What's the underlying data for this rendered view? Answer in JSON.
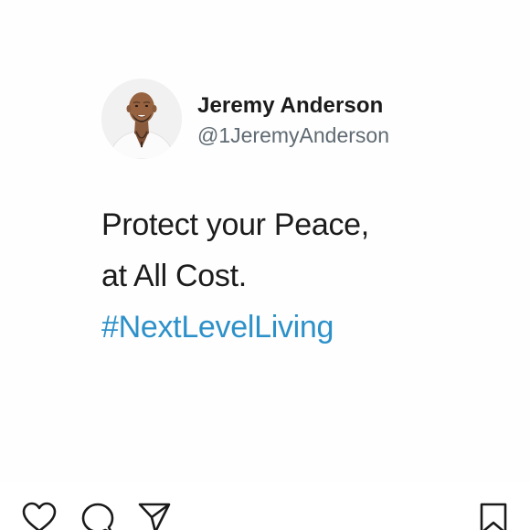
{
  "post": {
    "author_name": "Jeremy Anderson",
    "author_handle": "@1JeremyAnderson",
    "text_lines": [
      "Protect your Peace,",
      "at All Cost."
    ],
    "hashtag": "#NextLevelLiving",
    "hashtag_color": "#2d91c9"
  },
  "actions": {
    "icons": [
      "heart-icon",
      "comment-icon",
      "share-icon",
      "bookmark-icon"
    ]
  }
}
